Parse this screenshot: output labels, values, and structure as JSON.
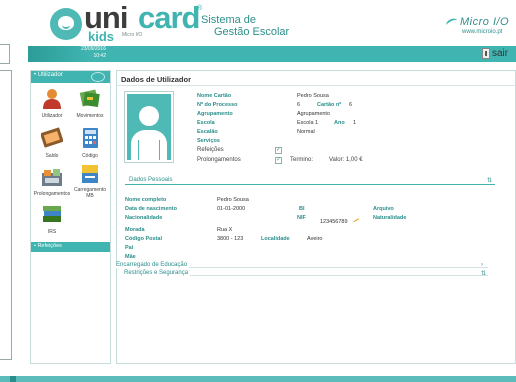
{
  "header": {
    "logo_uni": "uni",
    "logo_card": "card",
    "logo_reg": "®",
    "logo_kids": "kids",
    "logo_tag": "Micro I/O",
    "app_title_line1": "Sistema de",
    "app_title_line2": "Gestão Escolar",
    "vendor_name": "Micro I/O",
    "vendor_url": "www.microio.pt"
  },
  "strip": {
    "date": "23/09/2016",
    "time": "10:42",
    "exit_label": "sair"
  },
  "sidebar": {
    "head": "• Utilizador",
    "tiles": [
      {
        "label": "Utilizador",
        "icon": "user-icon"
      },
      {
        "label": "Movimentos",
        "icon": "movements-icon"
      },
      {
        "label": "Saldo",
        "icon": "balance-icon"
      },
      {
        "label": "Código",
        "icon": "calculator-icon"
      },
      {
        "label": "Prolongamentos",
        "icon": "extensions-icon"
      },
      {
        "label": "Carregamento MB",
        "icon": "mb-topup-icon"
      },
      {
        "label": "IRS",
        "icon": "irs-books-icon"
      }
    ],
    "section2": "• Refeições"
  },
  "panel": {
    "title": "Dados de Utilizador",
    "info": {
      "nome_cartao_label": "Nome Cartão",
      "nome_cartao_value": "Pedro Sousa",
      "processo_label": "Nº do Processo",
      "processo_value": "6",
      "cartao_label": "Cartão nº",
      "cartao_value": "6",
      "agrupamento_label": "Agrupamento",
      "agrupamento_value": "Agrupamento",
      "escola_label": "Escola",
      "escola_value": "Escola 1",
      "ano_label": "Ano",
      "ano_value": "1",
      "escalao_label": "Escalão",
      "escalao_value": "Normal",
      "servicos_label": "Serviços",
      "refeicoes_label": "Refeições",
      "prolongamentos_label": "Prolongamentos",
      "termino_label": "Termino:",
      "valor_label": "Valor: 1,00 €"
    },
    "dados_pessoais": {
      "title": "Dados Pessoais",
      "nome_label": "Nome completo",
      "nome_value": "Pedro Sousa",
      "nascimento_label": "Data de nascimento",
      "nascimento_value": "01-01-2000",
      "bi_label": "BI",
      "arquivo_label": "Arquivo",
      "nacionalidade_label": "Nacionalidade",
      "nif_label": "NIF",
      "nif_value": "123456789",
      "naturalidade_label": "Naturalidade",
      "morada_label": "Morada",
      "morada_value": "Rua X",
      "postal_label": "Código Postal",
      "postal_value": "3800 - 123",
      "localidade_label": "Localidade",
      "localidade_value": "Aveiro",
      "pai_label": "Pai",
      "mae_label": "Mãe"
    },
    "encarregado": "Encarregado de Educação",
    "restricoes": "Restrições e Segurança"
  }
}
